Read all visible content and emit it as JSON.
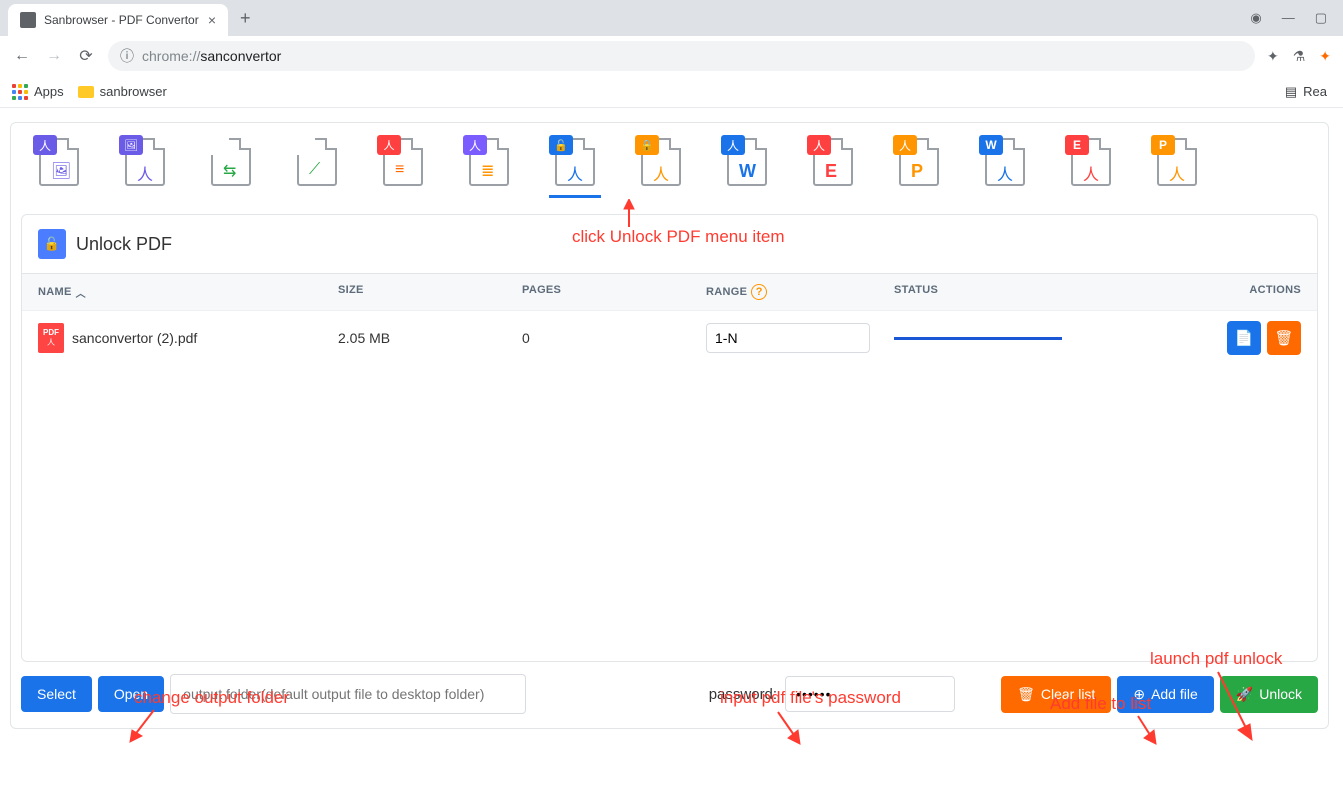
{
  "browser": {
    "tab_title": "Sanbrowser - PDF Convertor",
    "url_prefix": "chrome://",
    "url_path": "sanconvertor",
    "bookmarks": {
      "apps": "Apps",
      "sanbrowser": "sanbrowser",
      "reading_list": "Rea"
    }
  },
  "tools": [
    {
      "id": "pdf-to-image",
      "badge_bg": "#6b5ce7",
      "inner": "🖼",
      "inner_color": "#6b5ce7"
    },
    {
      "id": "image-to-pdf",
      "badge_bg": "#6b5ce7",
      "inner": "人",
      "inner_color": "#6b5ce7",
      "badge_icon": "🖼"
    },
    {
      "id": "split-pdf",
      "badge_bg": "#fff",
      "inner": "⇆",
      "inner_color": "#28a745"
    },
    {
      "id": "rotate-pdf",
      "badge_bg": "#fff",
      "inner": "⟋",
      "inner_color": "#28a745"
    },
    {
      "id": "merge-pdf",
      "badge_bg": "#ff4040",
      "inner": "≡",
      "inner_color": "#ff6a00",
      "badge_icon": "人"
    },
    {
      "id": "pdf-to-text",
      "badge_bg": "#7b5cff",
      "inner": "≣",
      "inner_color": "#ff9500"
    },
    {
      "id": "unlock-pdf",
      "badge_bg": "#1a73e8",
      "inner": "人",
      "inner_color": "#1a73e8",
      "active": true,
      "badge_icon": "🔓"
    },
    {
      "id": "protect-pdf",
      "badge_bg": "#ff9500",
      "inner": "人",
      "inner_color": "#ff9500",
      "badge_icon": "🔒"
    },
    {
      "id": "word-to-pdf",
      "badge_bg": "#1a73e8",
      "inner": "W",
      "inner_color": "#1a73e8",
      "letter": true
    },
    {
      "id": "excel-to-pdf",
      "badge_bg": "#ff4040",
      "inner": "E",
      "inner_color": "#ff4040",
      "letter": true
    },
    {
      "id": "ppt-to-pdf",
      "badge_bg": "#ff9500",
      "inner": "P",
      "inner_color": "#ff9500",
      "letter": true
    },
    {
      "id": "pdf-to-word",
      "badge_bg": "#1a73e8",
      "inner": "人",
      "inner_color": "#1a73e8",
      "badge_letter": "W"
    },
    {
      "id": "pdf-to-excel",
      "badge_bg": "#ff4040",
      "inner": "人",
      "inner_color": "#ff4040",
      "badge_letter": "E"
    },
    {
      "id": "pdf-to-ppt",
      "badge_bg": "#ff9500",
      "inner": "人",
      "inner_color": "#ff9500",
      "badge_letter": "P"
    }
  ],
  "section": {
    "title": "Unlock PDF"
  },
  "table": {
    "headers": {
      "name": "NAME",
      "size": "SIZE",
      "pages": "PAGES",
      "range": "RANGE",
      "status": "STATUS",
      "actions": "ACTIONS"
    },
    "rows": [
      {
        "name": "sanconvertor (2).pdf",
        "size": "2.05 MB",
        "pages": "0",
        "range": "1-N"
      }
    ]
  },
  "footer": {
    "select": "Select",
    "open": "Open",
    "folder_placeholder": "output folder(default output file to desktop folder)",
    "password_label": "password:",
    "password_value": "••••••",
    "clear": "Clear list",
    "add": "Add file",
    "unlock": "Unlock"
  },
  "annotations": {
    "a1": "click Unlock PDF menu item",
    "a2": "change output folder",
    "a3": "input pdf file's password",
    "a4": "Add file to list",
    "a5": "launch pdf unlock"
  }
}
